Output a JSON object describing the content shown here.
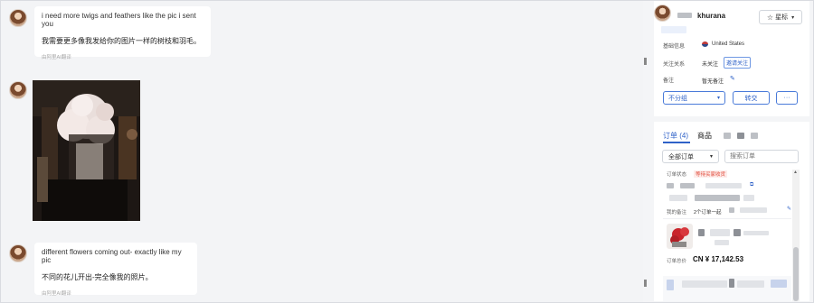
{
  "messages": [
    {
      "text_en": "i need more twigs and feathers like the pic i sent you",
      "text_zh": "我需要更多像我发给你的图片一样的树枝和羽毛。",
      "translate_note": "由阿里AI翻译"
    },
    {
      "text_en": "different flowers coming out- exactly like my pic",
      "text_zh": "不同的花儿开出-完全像我的照片。",
      "translate_note": "由阿里AI翻译"
    }
  ],
  "profile": {
    "name": "khurana",
    "star_button": "星标",
    "basic_info_label": "基础信息",
    "country": "United States",
    "follow_label": "关注关系",
    "follow_status": "未关注",
    "follow_tag": "邀请关注",
    "remark_label": "备注",
    "remark_value": "暂无备注",
    "group_select": "不分组",
    "transfer_button": "转交",
    "more_button": "···"
  },
  "orders": {
    "tab_orders": "订单 (4)",
    "tab_products": "商品",
    "filter_select": "全部订单",
    "search_placeholder": "搜索订单",
    "status_label": "订单状态",
    "status_value": "等待买家收货",
    "my_remark_label": "我的备注",
    "my_remark_value": "2个订单一起",
    "total_label": "订单总价",
    "total_value": "CN ¥ 17,142.53"
  },
  "colors": {
    "accent": "#2f62c8",
    "status_red": "#e24b3b"
  }
}
